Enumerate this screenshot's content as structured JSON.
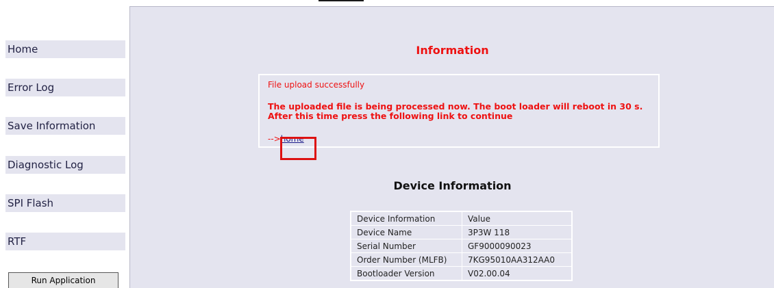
{
  "sidebar": {
    "items": [
      {
        "label": "Home"
      },
      {
        "label": "Error Log"
      },
      {
        "label": "Save Information"
      },
      {
        "label": "Diagnostic Log"
      },
      {
        "label": "SPI Flash"
      },
      {
        "label": "RTF"
      }
    ],
    "run_button": "Run Application"
  },
  "main": {
    "title": "Information",
    "message": {
      "status": "File upload successfully",
      "line1": "The uploaded file is being processed now. The boot loader will reboot in 30 s.",
      "line2": "After this time press the following link to continue",
      "arrow": "-->",
      "link": "home"
    },
    "device_title": "Device Information",
    "device_table": {
      "headers": [
        "Device Information",
        "Value"
      ],
      "rows": [
        [
          "Device Name",
          "3P3W 118"
        ],
        [
          "Serial Number",
          "GF9000090023"
        ],
        [
          "Order Number (MLFB)",
          "7KG95010AA312AA0"
        ],
        [
          "Bootloader Version",
          "V02.00.04"
        ]
      ]
    }
  },
  "colors": {
    "panel_bg": "#e4e4ef",
    "alert_red": "#ee1111",
    "highlight": "#dd1111",
    "link": "#1a1a88"
  }
}
